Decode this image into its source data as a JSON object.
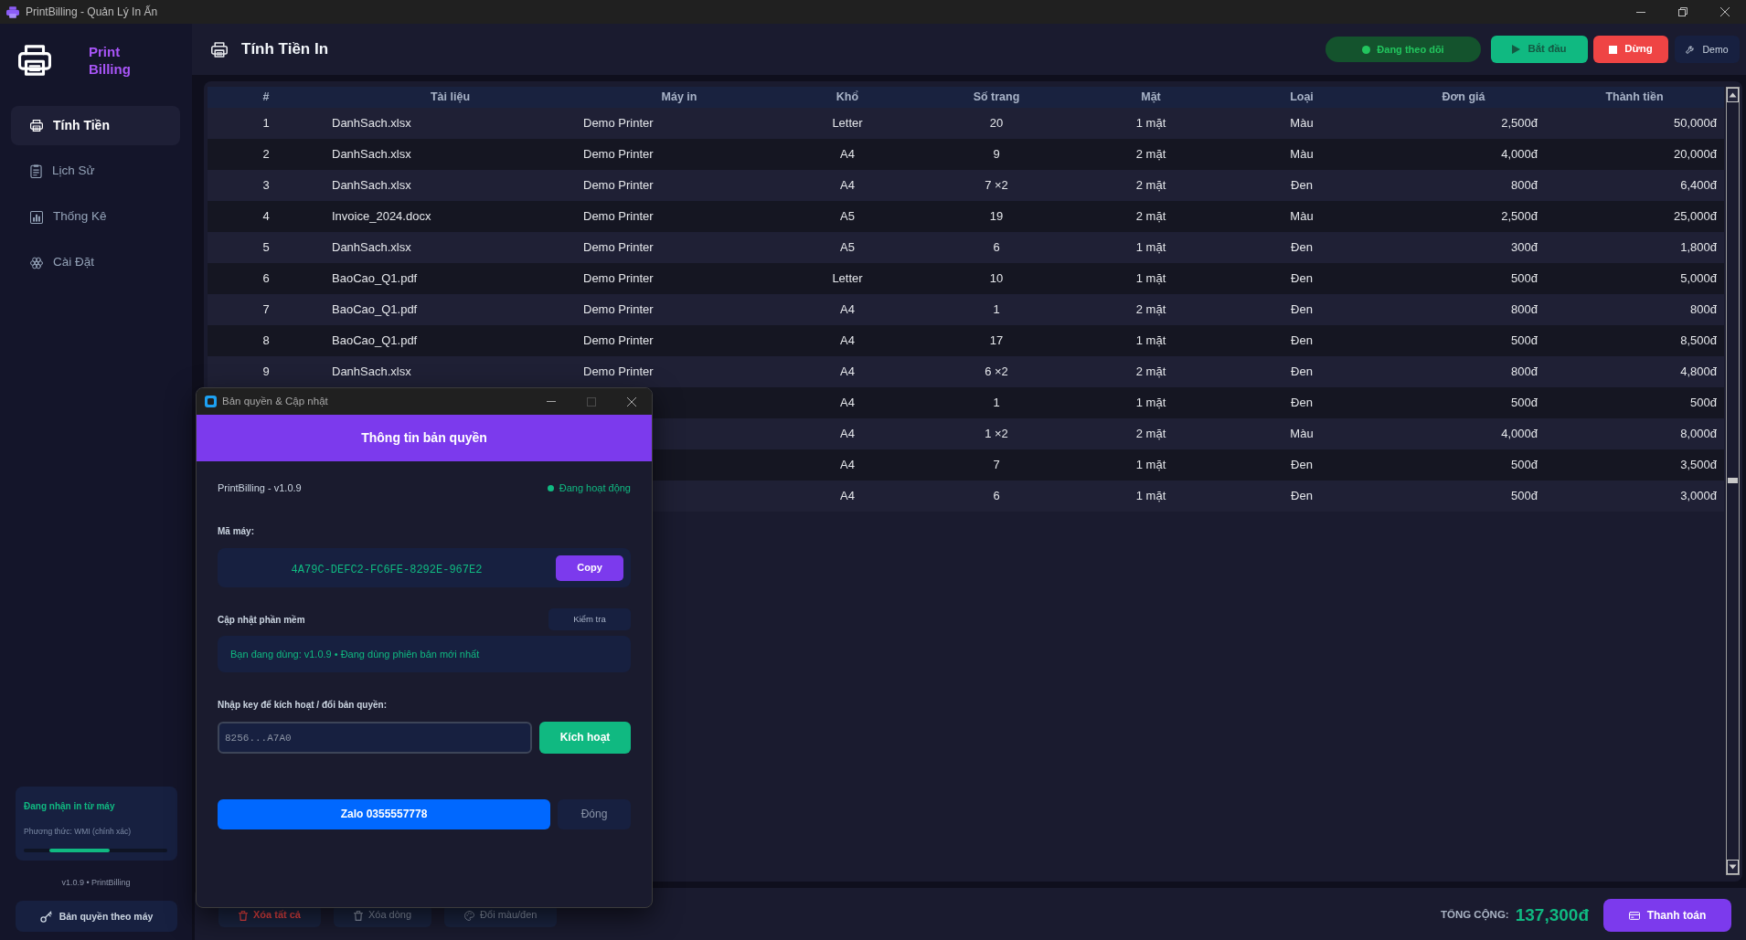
{
  "window": {
    "title": "PrintBilling - Quản Lý In Ấn"
  },
  "sidebar": {
    "brand": "Print Billing",
    "items": [
      {
        "label": "Tính Tiền",
        "kind": "billing",
        "selected": true
      },
      {
        "label": "Lịch Sử",
        "kind": "history",
        "selected": false
      },
      {
        "label": "Thống Kê",
        "kind": "stats",
        "selected": false
      },
      {
        "label": "Cài Đặt",
        "kind": "settings",
        "selected": false
      }
    ],
    "status_card": {
      "title": "Đang nhận in từ máy",
      "method": "Phương thức: WMI (chính xác)",
      "level": 0.42
    },
    "version": "v1.0.9 • PrintBilling",
    "license_button": "Bản quyền theo máy"
  },
  "header": {
    "title": "Tính Tiền In",
    "monitor_status": "Đang theo dõi",
    "buttons": [
      {
        "label": "Bắt đầu",
        "kind": "start",
        "disabled": true
      },
      {
        "label": "Dừng",
        "kind": "stop",
        "disabled": false
      },
      {
        "label": "Demo",
        "kind": "demo",
        "disabled": false
      }
    ]
  },
  "table": {
    "columns": [
      "#",
      "Tài liệu",
      "Máy in",
      "Khổ",
      "Số trang",
      "Mặt",
      "Loại",
      "Đơn giá",
      "Thành tiền"
    ],
    "rows": [
      {
        "no": "1",
        "document": "DanhSach.xlsx",
        "printer": "Demo Printer",
        "paper": "Letter",
        "pages": "20",
        "sides": "1 mặt",
        "mode": "Màu",
        "unit_price": "2,500đ",
        "amount": "50,000đ"
      },
      {
        "no": "2",
        "document": "DanhSach.xlsx",
        "printer": "Demo Printer",
        "paper": "A4",
        "pages": "9",
        "sides": "2 mặt",
        "mode": "Màu",
        "unit_price": "4,000đ",
        "amount": "20,000đ"
      },
      {
        "no": "3",
        "document": "DanhSach.xlsx",
        "printer": "Demo Printer",
        "paper": "A4",
        "pages": "7 ×2",
        "sides": "2 mặt",
        "mode": "Đen",
        "unit_price": "800đ",
        "amount": "6,400đ"
      },
      {
        "no": "4",
        "document": "Invoice_2024.docx",
        "printer": "Demo Printer",
        "paper": "A5",
        "pages": "19",
        "sides": "2 mặt",
        "mode": "Màu",
        "unit_price": "2,500đ",
        "amount": "25,000đ"
      },
      {
        "no": "5",
        "document": "DanhSach.xlsx",
        "printer": "Demo Printer",
        "paper": "A5",
        "pages": "6",
        "sides": "1 mặt",
        "mode": "Đen",
        "unit_price": "300đ",
        "amount": "1,800đ"
      },
      {
        "no": "6",
        "document": "BaoCao_Q1.pdf",
        "printer": "Demo Printer",
        "paper": "Letter",
        "pages": "10",
        "sides": "1 mặt",
        "mode": "Đen",
        "unit_price": "500đ",
        "amount": "5,000đ"
      },
      {
        "no": "7",
        "document": "BaoCao_Q1.pdf",
        "printer": "Demo Printer",
        "paper": "A4",
        "pages": "1",
        "sides": "2 mặt",
        "mode": "Đen",
        "unit_price": "800đ",
        "amount": "800đ"
      },
      {
        "no": "8",
        "document": "BaoCao_Q1.pdf",
        "printer": "Demo Printer",
        "paper": "A4",
        "pages": "17",
        "sides": "1 mặt",
        "mode": "Đen",
        "unit_price": "500đ",
        "amount": "8,500đ"
      },
      {
        "no": "9",
        "document": "DanhSach.xlsx",
        "printer": "Demo Printer",
        "paper": "A4",
        "pages": "6 ×2",
        "sides": "2 mặt",
        "mode": "Đen",
        "unit_price": "800đ",
        "amount": "4,800đ"
      },
      {
        "paper": "A4",
        "pages": "1",
        "sides": "1 mặt",
        "mode": "Đen",
        "unit_price": "500đ",
        "amount": "500đ"
      },
      {
        "paper": "A4",
        "pages": "1 ×2",
        "sides": "2 mặt",
        "mode": "Màu",
        "unit_price": "4,000đ",
        "amount": "8,000đ"
      },
      {
        "paper": "A4",
        "pages": "7",
        "sides": "1 mặt",
        "mode": "Đen",
        "unit_price": "500đ",
        "amount": "3,500đ"
      },
      {
        "paper": "A4",
        "pages": "6",
        "sides": "1 mặt",
        "mode": "Đen",
        "unit_price": "500đ",
        "amount": "3,000đ"
      }
    ]
  },
  "footer": {
    "actions": [
      {
        "label": "Xóa tất cả",
        "kind": "clear"
      },
      {
        "label": "Xóa dòng",
        "kind": "delete"
      },
      {
        "label": "Đổi màu/đen",
        "kind": "recolor"
      }
    ],
    "total_label": "TỔNG CỘNG:",
    "total": "137,300đ",
    "pay_button": "Thanh toán"
  },
  "dialog": {
    "title": "Bản quyền & Cập nhật",
    "heading": "Thông tin bản quyền",
    "product": "PrintBilling - v1.0.9",
    "status": "Đang hoạt động",
    "machine_label": "Mã máy:",
    "machine_id": "4A79C-DEFC2-FC6FE-8292E-967E2",
    "copy_button": "Copy",
    "update_label": "Cập nhật phần mềm",
    "check_button": "Kiểm tra",
    "update_info": "Bạn đang dùng: v1.0.9 • Đang dùng phiên bản mới nhất",
    "key_label": "Nhập key để kích hoạt / đổi bản quyền:",
    "key_field": {
      "placeholder": "8256...A7A0"
    },
    "activate_button": "Kích hoạt",
    "zalo_button": "Zalo 0355557778",
    "close_button": "Đóng"
  }
}
